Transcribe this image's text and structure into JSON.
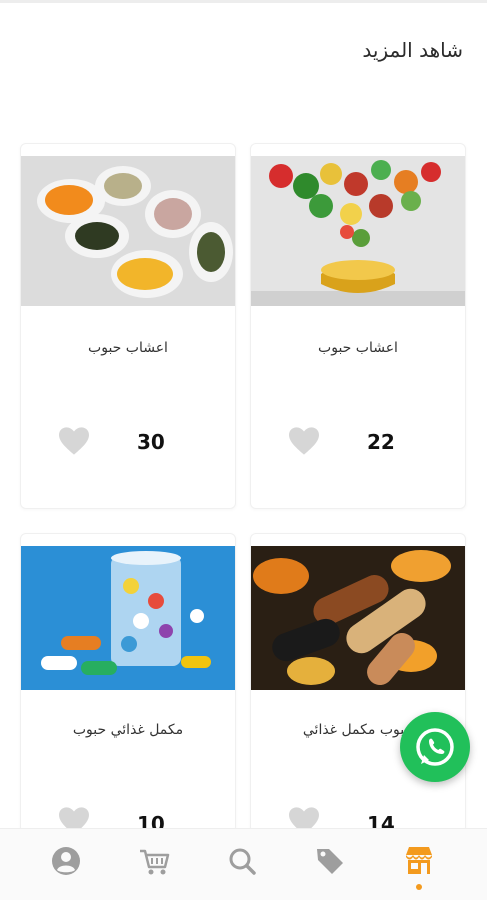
{
  "header": {
    "see_more": "شاهد المزيد"
  },
  "products": [
    {
      "name": "اعشاب حبوب",
      "likes": "22",
      "image_icon": "vegetables-capsule-image"
    },
    {
      "name": "اعشاب حبوب",
      "likes": "30",
      "image_icon": "supplement-spoons-image"
    },
    {
      "name": "حبوب مكمل غذائي",
      "likes": "14",
      "image_icon": "softgel-capsules-image"
    },
    {
      "name": "مكمل غذائي حبوب",
      "likes": "10",
      "image_icon": "pills-glass-image"
    }
  ],
  "nav": {
    "items": [
      {
        "icon": "profile-icon"
      },
      {
        "icon": "cart-icon"
      },
      {
        "icon": "search-icon"
      },
      {
        "icon": "tag-icon"
      },
      {
        "icon": "store-icon",
        "active": true
      }
    ]
  },
  "colors": {
    "accent": "#f39a1e",
    "whatsapp": "#21c05a",
    "inactive_icon": "#9e9e9e",
    "heart": "#d6d6d6"
  }
}
